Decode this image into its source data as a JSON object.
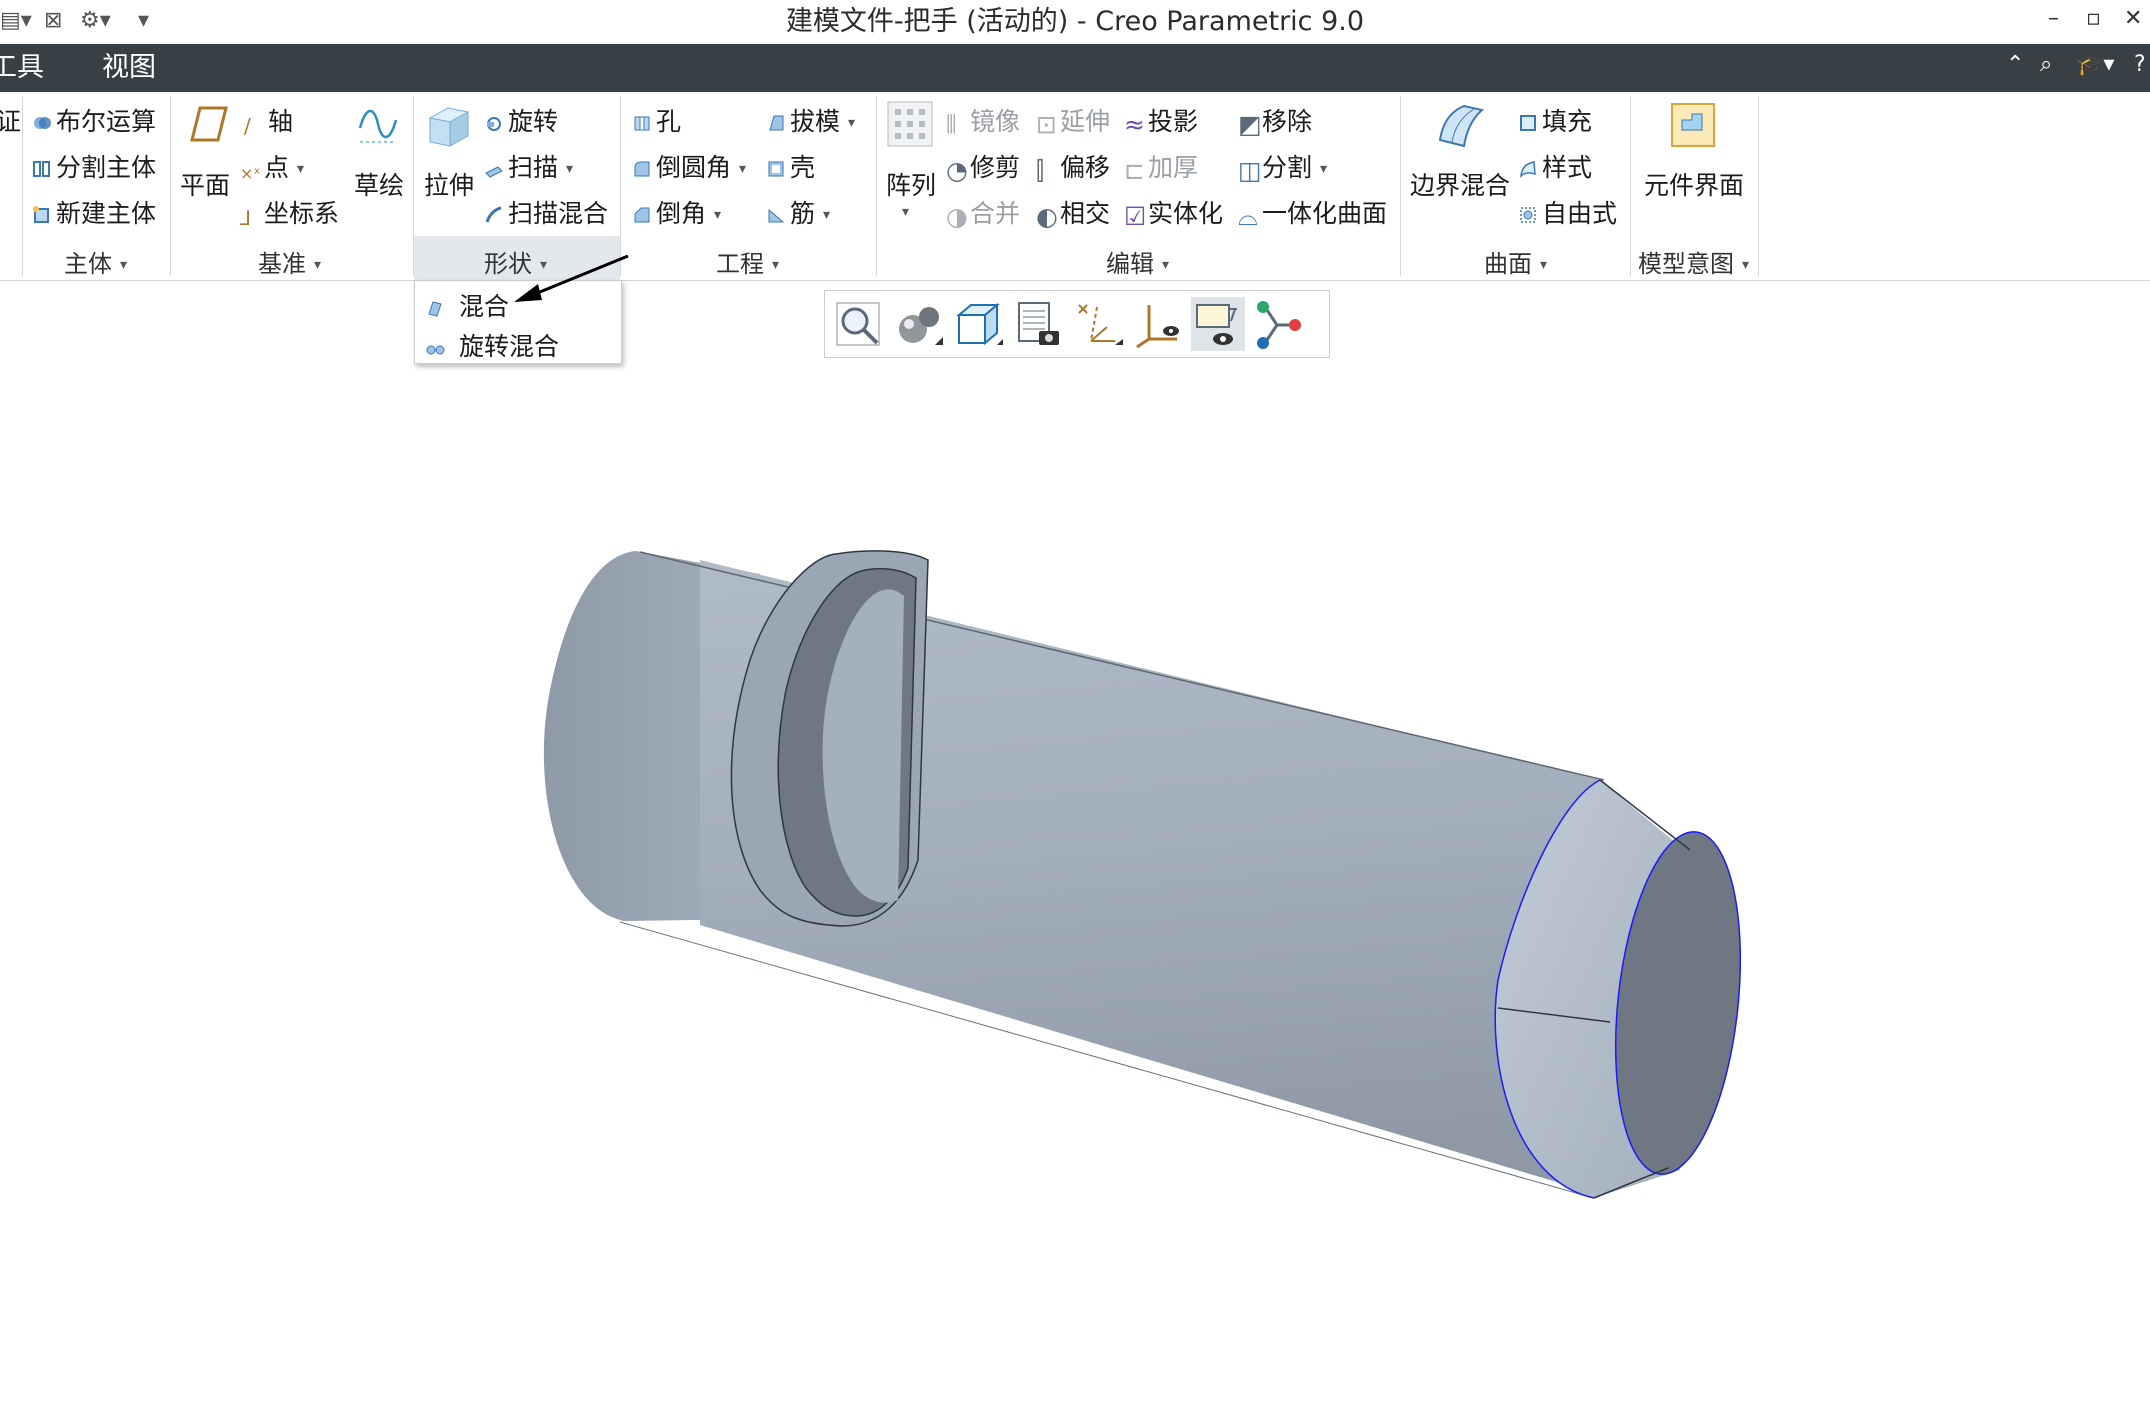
{
  "window": {
    "title": "建模文件-把手 (活动的) - Creo Parametric 9.0"
  },
  "quick_access": {
    "icons": [
      "new-icon",
      "close-window-icon",
      "regenerate-icon",
      "customize-icon"
    ]
  },
  "window_controls": {
    "minimize": "–",
    "restore": "▫",
    "close": "✕"
  },
  "menubar": {
    "items": [
      "工具",
      "视图"
    ],
    "right_icons": [
      "collapse-ribbon-icon",
      "search-icon",
      "learning-icon",
      "help-icon"
    ]
  },
  "ribbon": {
    "groups": {
      "body": {
        "label": "主体",
        "items": [
          "布尔运算",
          "分割主体",
          "新建主体"
        ],
        "left_partial": "证"
      },
      "datum": {
        "label": "基准",
        "plane": "平面",
        "axis": "轴",
        "point": "点",
        "csys": "坐标系",
        "sketch": "草绘"
      },
      "shape": {
        "label": "形状",
        "extrude": "拉伸",
        "revolve": "旋转",
        "sweep": "扫描",
        "swept_blend": "扫描混合"
      },
      "engineering": {
        "label": "工程",
        "hole": "孔",
        "round": "倒圆角",
        "chamfer": "倒角",
        "draft": "拔模",
        "shell": "壳",
        "rib": "筋"
      },
      "editing": {
        "label": "编辑",
        "pattern": "阵列",
        "mirror": "镜像",
        "trim": "修剪",
        "merge": "合并",
        "extend": "延伸",
        "offset": "偏移",
        "intersect": "相交",
        "project": "投影",
        "thicken": "加厚",
        "solidify": "实体化",
        "remove": "移除",
        "split": "分割",
        "unify": "一体化曲面"
      },
      "surfaces": {
        "label": "曲面",
        "boundary_blend": "边界混合",
        "fill": "填充",
        "style": "样式",
        "freestyle": "自由式"
      },
      "model_intent": {
        "label": "模型意图",
        "component_interface": "元件界面"
      }
    }
  },
  "shape_dropdown": {
    "items": [
      "混合",
      "旋转混合"
    ]
  },
  "view_toolbar": {
    "icons": [
      "refit-icon",
      "display-style-icon",
      "saved-orientations-icon",
      "view-manager-icon",
      "datum-display-icon",
      "csys-display-icon",
      "annotation-display-icon",
      "appearance-tree-icon"
    ]
  },
  "colors": {
    "menubar": "#394045",
    "model": "#a9b4c2",
    "accent": "#1a1aff"
  }
}
